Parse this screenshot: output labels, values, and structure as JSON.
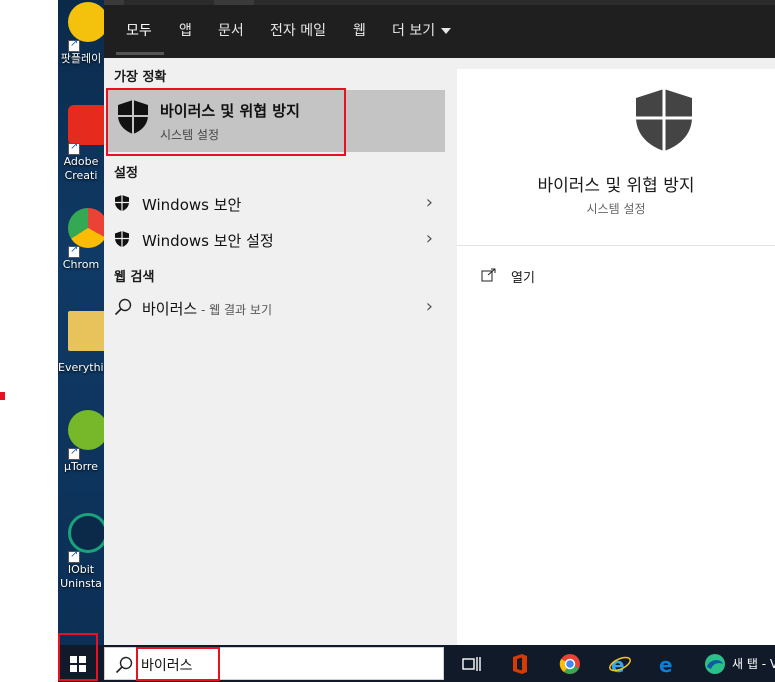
{
  "desktop": {
    "icons": [
      {
        "label": "팟플레이",
        "color": "#f4c20d"
      },
      {
        "label": "Adobe Creati",
        "color": "#e62b1e"
      },
      {
        "label": "Chrom",
        "color": "#4285f4"
      },
      {
        "label": "Everythin",
        "color": "#e8c25a"
      },
      {
        "label": "µTorre",
        "color": "#76b82a"
      },
      {
        "label": "IObit Uninsta",
        "color": "#1aa37a"
      }
    ]
  },
  "search_tabs": {
    "all": "모두",
    "apps": "앱",
    "documents": "문서",
    "email": "전자 메일",
    "web": "웹",
    "more": "더 보기"
  },
  "results": {
    "best_match_header": "가장 정확",
    "best_match": {
      "title": "바이러스 및 위협 방지",
      "subtitle": "시스템 설정"
    },
    "settings_header": "설정",
    "settings_items": [
      {
        "label": "Windows 보안"
      },
      {
        "label": "Windows 보안 설정"
      }
    ],
    "web_header": "웹 검색",
    "web_item": {
      "query": "바이러스",
      "suffix": " - 웹 결과 보기"
    }
  },
  "preview": {
    "title": "바이러스 및 위협 방지",
    "subtitle": "시스템 설정",
    "open_label": "열기"
  },
  "taskbar": {
    "search_value": "바이러스",
    "new_tab_label": "새 탭 - V"
  },
  "colors": {
    "highlight_red": "#e81123",
    "taskbar_bg": "#101a28",
    "tabs_bg": "#1f1f1f",
    "selected_bg": "#c4c4c4"
  }
}
